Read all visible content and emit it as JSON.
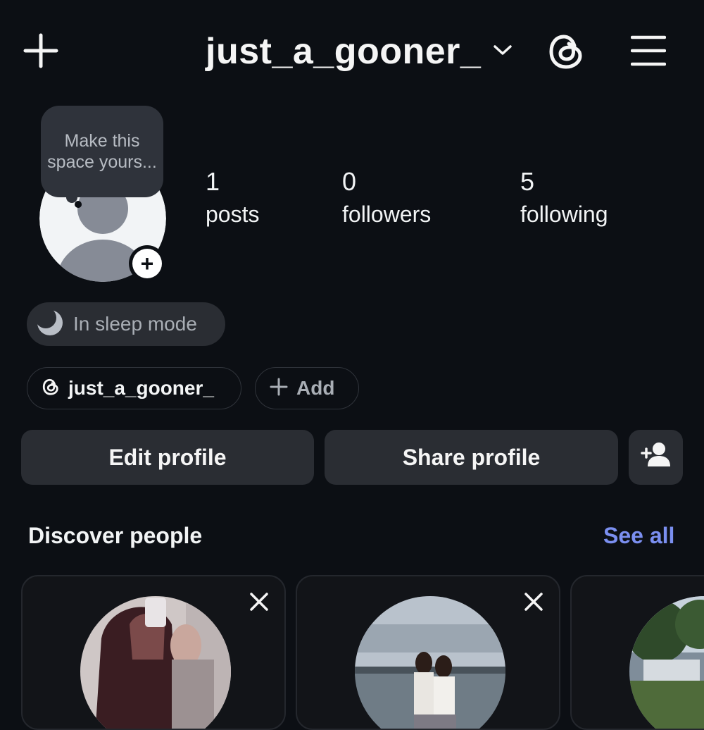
{
  "topbar": {
    "username": "just_a_gooner_",
    "icons": [
      "plus-icon",
      "chevron-down-icon",
      "threads-icon",
      "menu-icon"
    ]
  },
  "profile": {
    "note_bubble": "Make this space yours...",
    "stats": [
      {
        "value": "1",
        "label": "posts"
      },
      {
        "value": "0",
        "label": "followers"
      },
      {
        "value": "5",
        "label": "following"
      }
    ],
    "status_chip": "In sleep mode",
    "threads_handle": "just_a_gooner_",
    "add_chip": "Add"
  },
  "actions": {
    "edit_profile": "Edit profile",
    "share_profile": "Share profile"
  },
  "discover": {
    "title": "Discover people",
    "see_all": "See all"
  },
  "colors": {
    "background": "#0c0f14",
    "button_bg": "#2a2d33",
    "link_blue": "#7b8ff0"
  }
}
